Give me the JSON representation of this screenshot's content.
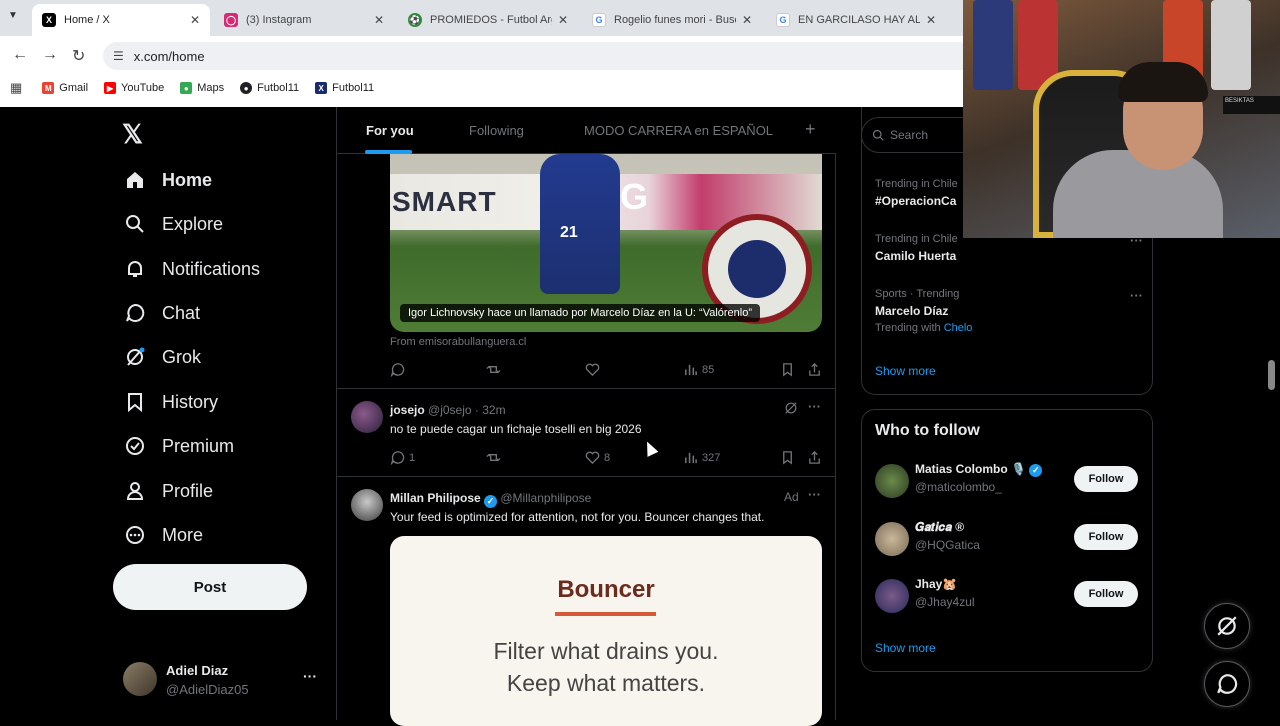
{
  "browser": {
    "tabs": [
      {
        "title": "Home / X",
        "icon": "x-logo-icon",
        "color": "#000000"
      },
      {
        "title": "(3) Instagram",
        "icon": "instagram-icon",
        "color": "#d62976"
      },
      {
        "title": "PROMIEDOS - Futbol Argen",
        "icon": "promiedos-icon",
        "color": "#2e8b3a"
      },
      {
        "title": "Rogelio funes mori - Buscar",
        "icon": "google-icon",
        "color": "#4285f4"
      },
      {
        "title": "EN GARCILASO HAY ALTUR",
        "icon": "google-icon",
        "color": "#4285f4"
      }
    ],
    "url": "x.com/home",
    "bookmarks": [
      {
        "label": "Gmail",
        "icon": "gmail-icon",
        "color": "#ea4335"
      },
      {
        "label": "YouTube",
        "icon": "youtube-icon",
        "color": "#ff0000"
      },
      {
        "label": "Maps",
        "icon": "maps-icon",
        "color": "#34a853"
      },
      {
        "label": "Futbol11",
        "icon": "globe-icon",
        "color": "#202124"
      },
      {
        "label": "Futbol11",
        "icon": "futbol11-icon",
        "color": "#1a2b6b"
      }
    ]
  },
  "nav": {
    "items": [
      {
        "label": "Home",
        "icon": "home-icon"
      },
      {
        "label": "Explore",
        "icon": "search-icon"
      },
      {
        "label": "Notifications",
        "icon": "bell-icon"
      },
      {
        "label": "Chat",
        "icon": "chat-icon"
      },
      {
        "label": "Grok",
        "icon": "grok-icon"
      },
      {
        "label": "History",
        "icon": "bookmark-icon"
      },
      {
        "label": "Premium",
        "icon": "verified-icon"
      },
      {
        "label": "Profile",
        "icon": "person-icon"
      },
      {
        "label": "More",
        "icon": "more-circle-icon"
      }
    ],
    "post_label": "Post",
    "account": {
      "name": "Adiel Diaz",
      "handle": "@AdielDiaz05"
    }
  },
  "feed": {
    "tabs": [
      "For you",
      "Following",
      "MODO CARRERA en ESPAÑOL"
    ],
    "tweet1": {
      "media_caption": "Igor Lichnovsky hace un llamado por Marcelo Díaz en la U: “Valórenlo”",
      "from": "From emisorabullanguera.cl",
      "views": "85",
      "banner_text1": "SMART",
      "banner_text2": "PING",
      "jersey_number": "21"
    },
    "tweet2": {
      "name": "josejo",
      "handle": "@j0sejo",
      "time": "· 32m",
      "text": "no te puede cagar un fichaje toselli en big 2026",
      "replies": "1",
      "likes": "8",
      "views": "327"
    },
    "tweet3": {
      "name": "Millan Philipose",
      "handle": "@Millanphilipose",
      "ad_label": "Ad",
      "text": "Your feed is optimized for attention, not for you. Bouncer changes that.",
      "card_title": "Bouncer",
      "card_line1": "Filter what drains you.",
      "card_line2": "Keep what matters."
    }
  },
  "right": {
    "search_placeholder": "Search",
    "trends": [
      {
        "meta": "Trending in Chile",
        "title": "#OperacionCa",
        "with": ""
      },
      {
        "meta": "Trending in Chile",
        "title": "Camilo Huerta",
        "with": ""
      },
      {
        "meta": "Sports · Trending",
        "title": "Marcelo Díaz",
        "with_prefix": "Trending with",
        "with": "Chelo"
      }
    ],
    "show_more": "Show more",
    "who_to_follow": {
      "title": "Who to follow",
      "users": [
        {
          "name": "Matias Colombo 🎙️",
          "handle": "@maticolombo_",
          "button": "Follow"
        },
        {
          "name": "𝑮𝒂𝒕𝒊𝒄𝒂 ®",
          "handle": "@HQGatica",
          "button": "Follow"
        },
        {
          "name": "Jhay🐹",
          "handle": "@Jhay4zul",
          "button": "Follow"
        }
      ],
      "show_more": "Show more"
    }
  },
  "webcam": {
    "shelf_text": "BESIKTAS"
  }
}
